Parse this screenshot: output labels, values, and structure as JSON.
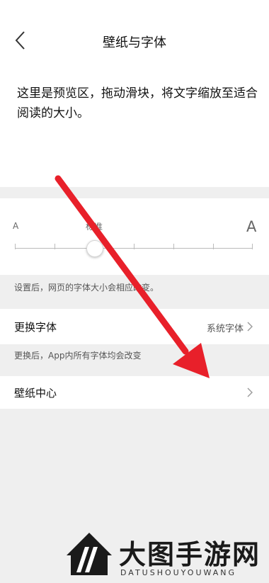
{
  "header": {
    "title": "壁纸与字体"
  },
  "preview": {
    "text": "这里是预览区，拖动滑块，将文字缩放至适合阅读的大小。"
  },
  "slider": {
    "small_label": "A",
    "large_label": "A",
    "standard_label": "标准",
    "value_step": 2,
    "step_count": 7
  },
  "font_note": "设置后，网页的字体大小会相应改变。",
  "font_row": {
    "label": "更换字体",
    "value": "系统字体"
  },
  "app_note": "更换后，App内所有字体均会改变",
  "wallpaper_row": {
    "label": "壁纸中心"
  },
  "watermark": {
    "main": "大图手游网",
    "sub": "DATUSHOUYOUWANG"
  },
  "colors": {
    "arrow": "#e8202a",
    "background": "#efefef"
  }
}
